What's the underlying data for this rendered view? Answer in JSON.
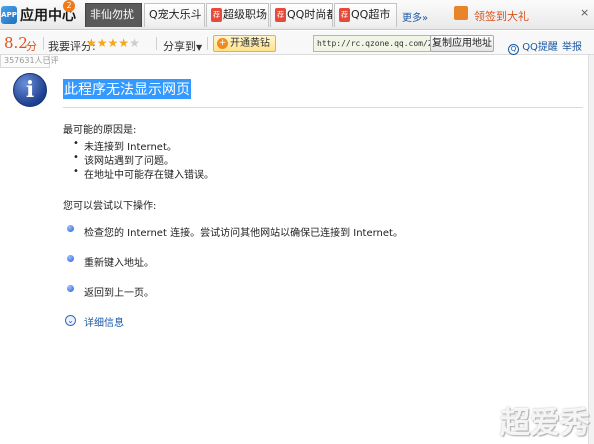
{
  "app": {
    "logo_icon_text": "APP",
    "title": "应用中心",
    "badge": "2"
  },
  "tabs": [
    {
      "label": "非仙勿扰",
      "hot": false,
      "active": true
    },
    {
      "label": "Q宠大乐斗",
      "hot": false,
      "active": false
    },
    {
      "label": "超级职场",
      "hot": true,
      "active": false
    },
    {
      "label": "QQ时尚都",
      "hot": true,
      "active": false
    },
    {
      "label": "QQ超市",
      "hot": true,
      "active": false
    }
  ],
  "hot_badge": "荐",
  "more_label": "更多»",
  "gift": {
    "label": "领签到大礼",
    "close": "×"
  },
  "infobar": {
    "score": "8.2",
    "score_unit": "分",
    "rate_label": "我要评分:",
    "rating": 4,
    "rating_max": 5,
    "share_label": "分享到",
    "share_caret": "▼",
    "vip_label": "开通黄钻",
    "vip_plus": "+",
    "url": "http://rc.qzone.qq.com/2",
    "copy_label": "复制应用地址",
    "qq_remind_label": "QQ提醒",
    "qq_remind_icon": "Q",
    "report_label": "举报",
    "user_count": "357631人已评"
  },
  "error": {
    "icon_glyph": "i",
    "title": "此程序无法显示网页",
    "causes_heading": "最可能的原因是:",
    "causes": [
      "未连接到 Internet。",
      "该网站遇到了问题。",
      "在地址中可能存在键入错误。"
    ],
    "try_heading": "您可以尝试以下操作:",
    "actions": [
      "检查您的 Internet 连接。尝试访问其他网站以确保已连接到 Internet。",
      "重新键入地址。",
      "返回到上一页。"
    ],
    "more_info_icon": "⌄",
    "more_info": "详细信息"
  },
  "watermark": "超爱秀",
  "colors": {
    "accent_orange": "#e0531c",
    "link_blue": "#1a5aa6",
    "title_highlight": "#3399ff",
    "star_on": "#f3a71c",
    "star_off": "#cccccc"
  }
}
